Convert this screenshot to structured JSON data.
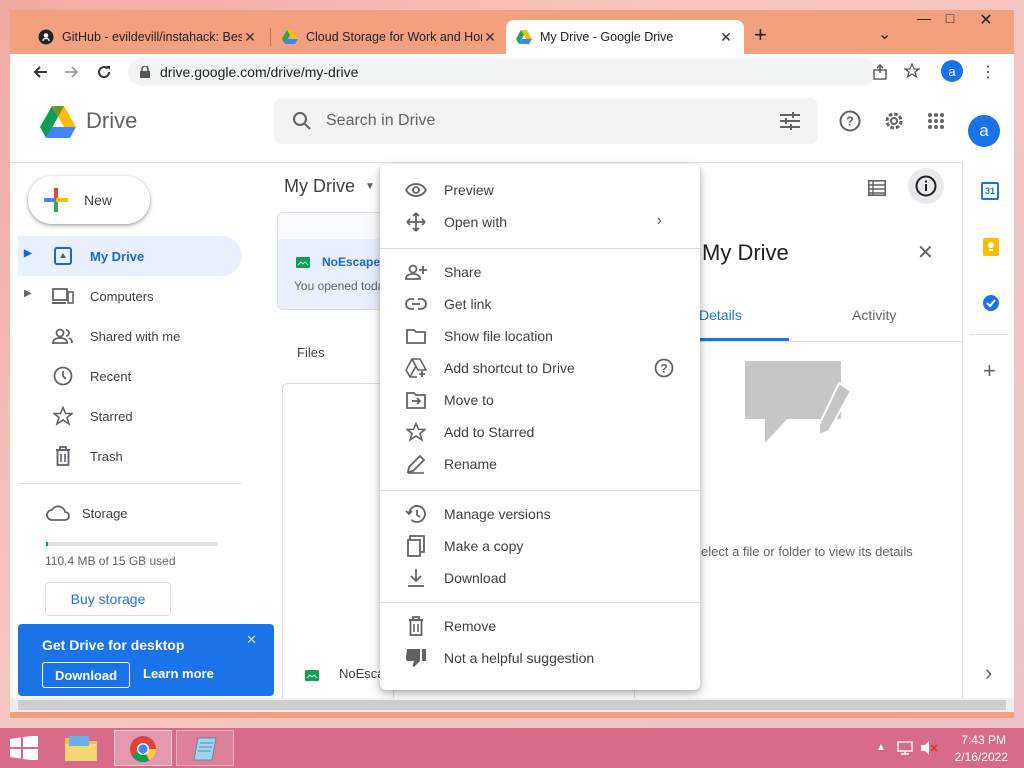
{
  "browser": {
    "tabs": [
      {
        "title": "GitHub - evildevill/instahack: Bes",
        "close": "✕"
      },
      {
        "title": "Cloud Storage for Work and Hom",
        "close": "✕"
      },
      {
        "title": "My Drive - Google Drive",
        "close": "✕"
      }
    ],
    "new_tab": "+",
    "tab_menu": "⌄",
    "window_controls": {
      "minimize": "—",
      "maximize": "□",
      "close": "✕"
    },
    "url": "drive.google.com/drive/my-drive",
    "profile_initial": "a"
  },
  "drive": {
    "logo_text": "Drive",
    "search_placeholder": "Search in Drive",
    "account_initial": "a",
    "new_button": "New",
    "nav": [
      {
        "label": "My Drive",
        "selected": true
      },
      {
        "label": "Computers",
        "selected": false
      },
      {
        "label": "Shared with me",
        "selected": false
      },
      {
        "label": "Recent",
        "selected": false
      },
      {
        "label": "Starred",
        "selected": false
      },
      {
        "label": "Trash",
        "selected": false
      }
    ],
    "storage": {
      "label": "Storage",
      "usage_text": "110.4 MB of 15 GB used",
      "used_fraction": 0.007,
      "buy_button": "Buy storage"
    },
    "promo": {
      "title": "Get Drive for desktop",
      "download": "Download",
      "learn_more": "Learn more",
      "close": "✕"
    },
    "main": {
      "title": "My Drive",
      "suggested_file_name": "NoEscape",
      "suggested_file_sub": "You opened today",
      "files_label": "Files",
      "file_card_name": "NoEsca"
    },
    "details": {
      "title": "My Drive",
      "tab_details": "Details",
      "tab_activity": "Activity",
      "empty_text": "elect a file or folder to view its details",
      "close": "✕"
    },
    "context_menu": {
      "groups": [
        [
          {
            "label": "Preview",
            "icon": "eye-icon"
          },
          {
            "label": "Open with",
            "icon": "move-arrows-icon",
            "submenu": true
          }
        ],
        [
          {
            "label": "Share",
            "icon": "person-add-icon"
          },
          {
            "label": "Get link",
            "icon": "link-icon"
          },
          {
            "label": "Show file location",
            "icon": "folder-icon"
          },
          {
            "label": "Add shortcut to Drive",
            "icon": "drive-shortcut-icon",
            "help": true
          },
          {
            "label": "Move to",
            "icon": "move-to-icon"
          },
          {
            "label": "Add to Starred",
            "icon": "star-icon"
          },
          {
            "label": "Rename",
            "icon": "pencil-icon"
          }
        ],
        [
          {
            "label": "Manage versions",
            "icon": "history-icon"
          },
          {
            "label": "Make a copy",
            "icon": "copy-icon"
          },
          {
            "label": "Download",
            "icon": "download-icon"
          }
        ],
        [
          {
            "label": "Remove",
            "icon": "trash-icon"
          },
          {
            "label": "Not a helpful suggestion",
            "icon": "thumb-down-icon"
          }
        ]
      ]
    },
    "side_panel": {
      "calendar_day": "31",
      "add": "+",
      "expand": "›"
    }
  },
  "taskbar": {
    "time": "7:43 PM",
    "date": "2/16/2022"
  },
  "colors": {
    "accent_blue": "#1a73e8",
    "selected_bg": "#e8f0fe",
    "promo_bg": "#1a73e8",
    "titlebar": "#f3a07f",
    "taskbar": "#d86b8a"
  }
}
